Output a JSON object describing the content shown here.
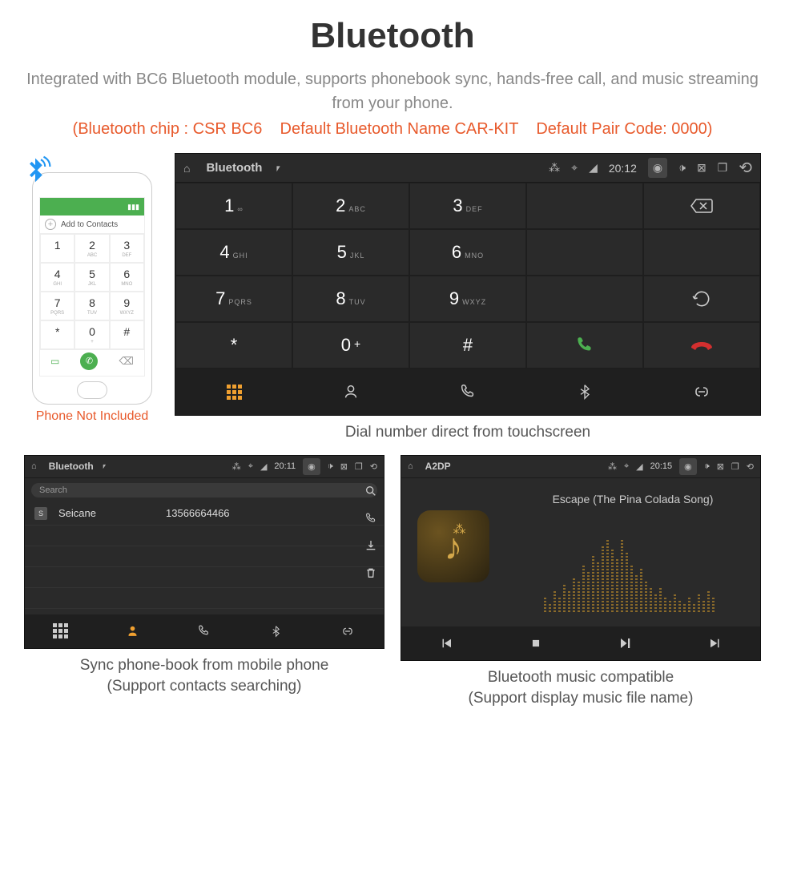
{
  "header": {
    "title": "Bluetooth",
    "subtitle": "Integrated with BC6 Bluetooth module, supports phonebook sync, hands-free call, and music streaming from your phone.",
    "specs": "(Bluetooth chip : CSR BC6    Default Bluetooth Name CAR-KIT    Default Pair Code: 0000)"
  },
  "phone": {
    "caption": "Phone Not Included",
    "add_contacts": "Add to Contacts",
    "keys": [
      {
        "n": "1",
        "l": ""
      },
      {
        "n": "2",
        "l": "ABC"
      },
      {
        "n": "3",
        "l": "DEF"
      },
      {
        "n": "4",
        "l": "GHI"
      },
      {
        "n": "5",
        "l": "JKL"
      },
      {
        "n": "6",
        "l": "MNO"
      },
      {
        "n": "7",
        "l": "PQRS"
      },
      {
        "n": "8",
        "l": "TUV"
      },
      {
        "n": "9",
        "l": "WXYZ"
      },
      {
        "n": "*",
        "l": ""
      },
      {
        "n": "0",
        "l": "+"
      },
      {
        "n": "#",
        "l": ""
      }
    ]
  },
  "dialer": {
    "status": {
      "title": "Bluetooth",
      "time": "20:12"
    },
    "keys": [
      {
        "n": "1",
        "l": "∞"
      },
      {
        "n": "2",
        "l": "ABC"
      },
      {
        "n": "3",
        "l": "DEF"
      },
      {
        "n": "4",
        "l": "GHI"
      },
      {
        "n": "5",
        "l": "JKL"
      },
      {
        "n": "6",
        "l": "MNO"
      },
      {
        "n": "7",
        "l": "PQRS"
      },
      {
        "n": "8",
        "l": "TUV"
      },
      {
        "n": "9",
        "l": "WXYZ"
      },
      {
        "n": "*",
        "l": ""
      },
      {
        "n": "0",
        "l": "+",
        "plus": true
      },
      {
        "n": "#",
        "l": ""
      }
    ],
    "caption": "Dial number direct from touchscreen"
  },
  "phonebook": {
    "status": {
      "title": "Bluetooth",
      "time": "20:11"
    },
    "search_placeholder": "Search",
    "contact": {
      "badge": "S",
      "name": "Seicane",
      "number": "13566664466"
    },
    "caption_l1": "Sync phone-book from mobile phone",
    "caption_l2": "(Support contacts searching)"
  },
  "music": {
    "status": {
      "title": "A2DP",
      "time": "20:15"
    },
    "song": "Escape (The Pina Colada Song)",
    "caption_l1": "Bluetooth music compatible",
    "caption_l2": "(Support display music file name)"
  }
}
